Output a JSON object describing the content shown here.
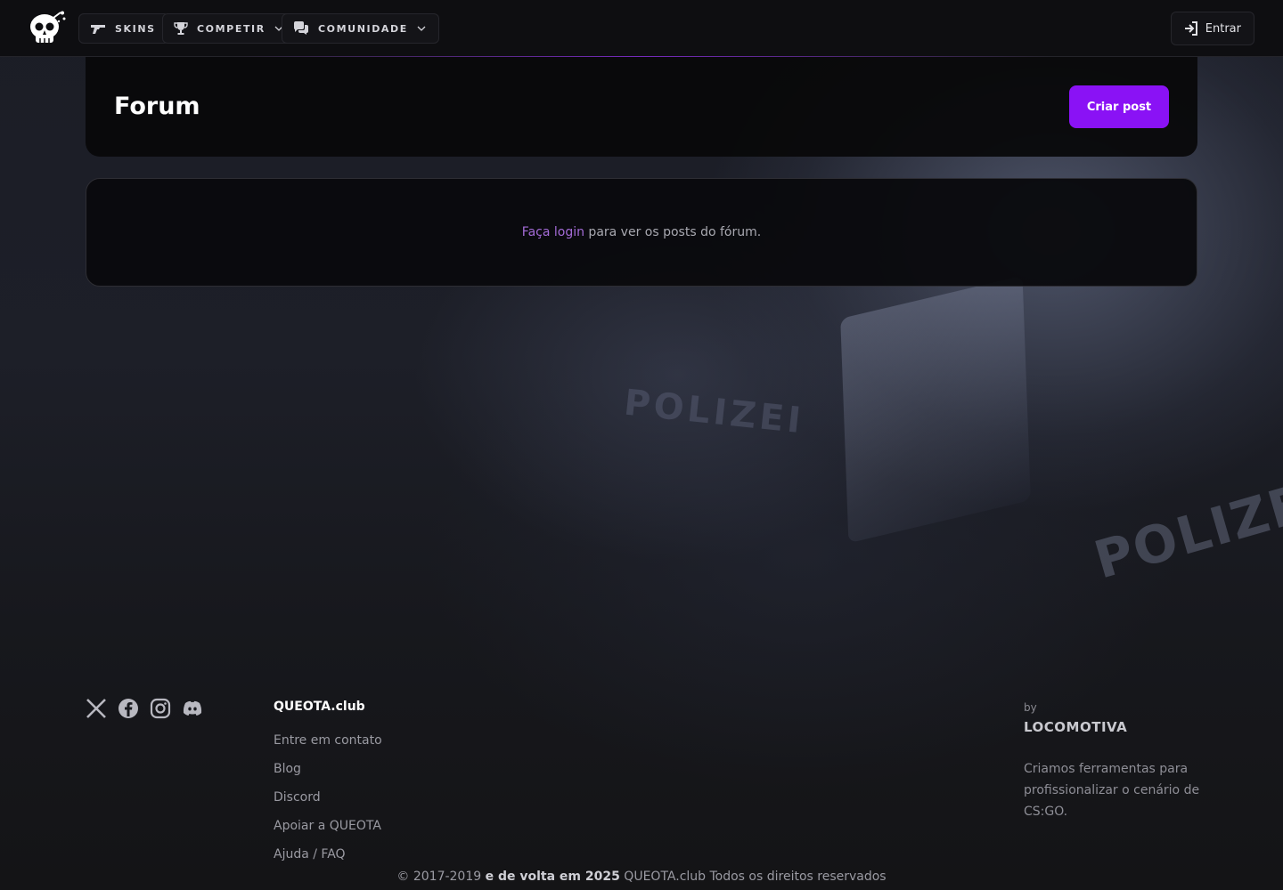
{
  "nav": {
    "items": [
      {
        "label": "SKINS",
        "icon": "gun-icon",
        "dropdown": false
      },
      {
        "label": "COMPETIR",
        "icon": "trophy-icon",
        "dropdown": true
      },
      {
        "label": "COMUNIDADE",
        "icon": "chat-bubbles-icon",
        "dropdown": true
      }
    ],
    "login_label": "Entrar"
  },
  "page": {
    "title": "Forum",
    "create_button": "Criar post"
  },
  "login_prompt": {
    "link_text": "Faça login",
    "rest_text": " para ver os posts do fórum."
  },
  "footer": {
    "social_icons": [
      "x-icon",
      "facebook-icon",
      "instagram-icon",
      "discord-icon"
    ],
    "brand": "QUEOTA.club",
    "links": [
      "Entre em contato",
      "Blog",
      "Discord",
      "Apoiar a QUEOTA",
      "Ajuda / FAQ"
    ],
    "by_label": "by",
    "company": "LOCOMOTIVA",
    "company_tagline": "Criamos ferramentas para profissionalizar o cenário de CS:GO.",
    "copyright_prefix": "© 2017-2019 ",
    "copyright_bold": "e de volta em 2025",
    "copyright_suffix": " QUEOTA.club Todos os direitos reservados"
  },
  "colors": {
    "accent": "#8a12f5",
    "link": "#a36bd6",
    "background": "#121214"
  }
}
